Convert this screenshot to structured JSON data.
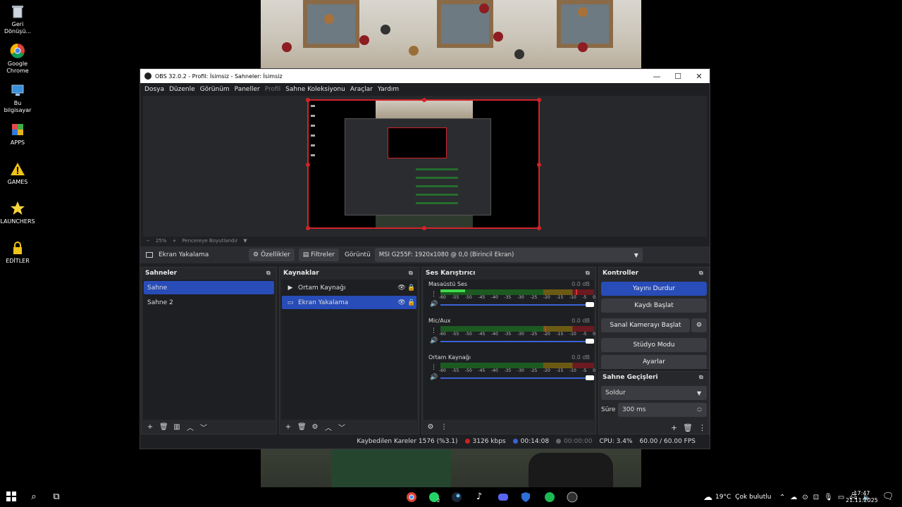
{
  "desktop": {
    "icons": [
      {
        "label": "Geri Dönüşü...",
        "icon": "recycle-bin-icon"
      },
      {
        "label": "Google Chrome",
        "icon": "chrome-icon"
      },
      {
        "label": "Bu bilgisayar",
        "icon": "computer-icon"
      },
      {
        "label": "APPS",
        "icon": "apps-folder-icon"
      },
      {
        "label": "GAMES",
        "icon": "games-warning-icon"
      },
      {
        "label": "LAUNCHERS",
        "icon": "star-icon"
      },
      {
        "label": "EDİTLER",
        "icon": "lock-icon"
      }
    ]
  },
  "window": {
    "title": "OBS 32.0.2 - Profil: İsimsiz - Sahneler: İsimsiz",
    "minimize": "—",
    "maximize": "☐",
    "close": "✕"
  },
  "menu": [
    "Dosya",
    "Düzenle",
    "Görünüm",
    "Paneller",
    "Profil",
    "Sahne Koleksiyonu",
    "Araçlar",
    "Yardım"
  ],
  "zoom": {
    "minus": "−",
    "value": "25%",
    "plus": "+",
    "fit": "Pencereye Boyutlandır",
    "arrow": "▼"
  },
  "sourcebar": {
    "source_name": "Ekran Yakalama",
    "properties": "Özellikler",
    "filters": "Filtreler",
    "display_label": "Görüntü",
    "display_value": "MSI G255F: 1920x1080 @ 0,0 (Birincil Ekran)"
  },
  "scenes": {
    "title": "Sahneler",
    "items": [
      "Sahne",
      "Sahne 2"
    ],
    "selected": 0
  },
  "sources": {
    "title": "Kaynaklar",
    "items": [
      {
        "label": "Ortam Kaynağı",
        "icon": "play-icon"
      },
      {
        "label": "Ekran Yakalama",
        "icon": "monitor-icon"
      }
    ],
    "selected": 1
  },
  "mixer": {
    "title": "Ses Karıştırıcı",
    "scale": [
      "-60",
      "-55",
      "-50",
      "-45",
      "-40",
      "-35",
      "-30",
      "-25",
      "-20",
      "-15",
      "-10",
      "-5",
      "0"
    ],
    "channels": [
      {
        "name": "Masaüstü Ses",
        "db": "0.0 dB",
        "level": 0.16,
        "peak": 0.88
      },
      {
        "name": "Mic/Aux",
        "db": "0.0 dB",
        "level": 0,
        "peak": 0.68
      },
      {
        "name": "Ortam Kaynağı",
        "db": "0.0 dB",
        "level": 0,
        "peak": null
      }
    ]
  },
  "controls": {
    "title": "Kontroller",
    "stop_stream": "Yayını Durdur",
    "start_record": "Kaydı Başlat",
    "start_vcam": "Sanal Kamerayı Başlat",
    "studio_mode": "Stüdyo Modu",
    "settings": "Ayarlar"
  },
  "transitions": {
    "title": "Sahne Geçişleri",
    "type": "Soldur",
    "duration_label": "Süre",
    "duration_value": "300 ms"
  },
  "status": {
    "dropped": "Kaybedilen Kareler 1576 (%3.1)",
    "bitrate": "3126 kbps",
    "stream_time": "00:14:08",
    "record_time": "00:00:00",
    "cpu": "CPU: 3.4%",
    "fps": "60.00 / 60.00 FPS"
  },
  "taskbar": {
    "weather_temp": "19°C",
    "weather_text": "Çok bulutlu",
    "time": "17:47",
    "date": "21.11.2025",
    "whatsapp_badge": "2"
  },
  "colors": {
    "accent": "#284cb8",
    "selection_border": "#d2232a",
    "meter_green": "#3ed74a"
  }
}
